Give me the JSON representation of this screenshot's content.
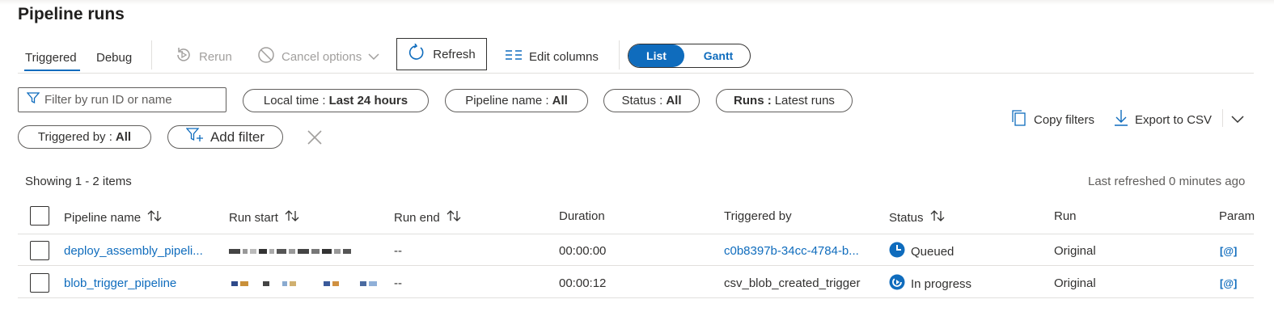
{
  "page": {
    "title": "Pipeline runs"
  },
  "tabs": {
    "triggered": "Triggered",
    "debug": "Debug"
  },
  "toolbar": {
    "rerun": "Rerun",
    "cancel_options": "Cancel options",
    "refresh": "Refresh",
    "edit_columns": "Edit columns",
    "view_toggle": {
      "list": "List",
      "gantt": "Gantt",
      "selected": "List"
    }
  },
  "filters": {
    "search_placeholder": "Filter by run ID or name",
    "search_value": "",
    "local_time": {
      "label": "Local time :",
      "value": "Last 24 hours"
    },
    "pipeline_name": {
      "label": "Pipeline name :",
      "value": "All"
    },
    "status": {
      "label": "Status :",
      "value": "All"
    },
    "runs": {
      "label": "Runs :",
      "value": "Latest runs"
    },
    "triggered_by": {
      "label": "Triggered by :",
      "value": "All"
    },
    "add_filter": "Add filter",
    "copy_filters": "Copy filters",
    "export_csv": "Export to CSV"
  },
  "table": {
    "showing": "Showing 1 - 2 items",
    "last_refreshed": "Last refreshed 0 minutes ago",
    "columns": {
      "pipeline_name": "Pipeline name",
      "run_start": "Run start",
      "run_end": "Run end",
      "duration": "Duration",
      "triggered_by": "Triggered by",
      "status": "Status",
      "run": "Run",
      "parameters": "Param"
    },
    "rows": [
      {
        "pipeline_name": "deploy_assembly_pipeli...",
        "run_end": "--",
        "duration": "00:00:00",
        "triggered_by": "c0b8397b-34cc-4784-b...",
        "status": "Queued",
        "run": "Original",
        "params": "[@]"
      },
      {
        "pipeline_name": "blob_trigger_pipeline",
        "run_end": "--",
        "duration": "00:00:12",
        "triggered_by": "csv_blob_created_trigger",
        "status": "In progress",
        "run": "Original",
        "params": "[@]"
      }
    ]
  },
  "colors": {
    "accent": "#0f6cbd",
    "text": "#323130",
    "border": "#e1dfdd",
    "disabled": "#a19f9d"
  },
  "icons": [
    "rerun-icon",
    "cancel-icon",
    "chevron-down-icon",
    "refresh-icon",
    "edit-columns-icon",
    "filter-icon",
    "add-filter-icon",
    "close-icon",
    "copy-icon",
    "download-icon",
    "sort-icon",
    "queued-icon",
    "in-progress-icon"
  ]
}
